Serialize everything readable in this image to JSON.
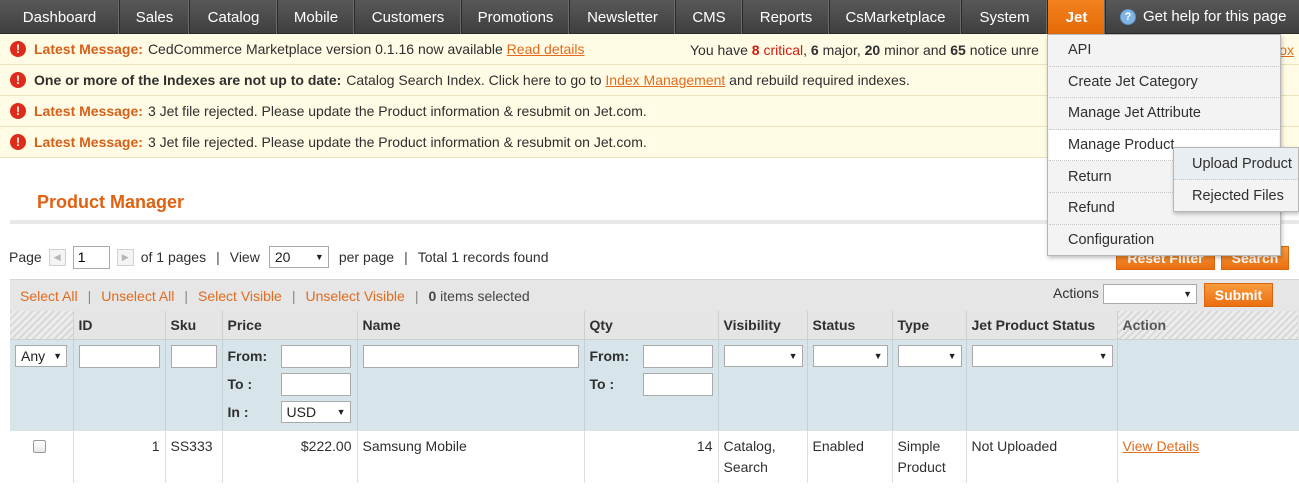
{
  "nav": {
    "items": [
      {
        "label": "Dashboard"
      },
      {
        "label": "Sales"
      },
      {
        "label": "Catalog"
      },
      {
        "label": "Mobile"
      },
      {
        "label": "Customers"
      },
      {
        "label": "Promotions"
      },
      {
        "label": "Newsletter"
      },
      {
        "label": "CMS"
      },
      {
        "label": "Reports"
      },
      {
        "label": "CsMarketplace"
      },
      {
        "label": "System"
      },
      {
        "label": "Jet"
      }
    ],
    "help_label": "Get help for this page",
    "help_icon": "question-circle-icon"
  },
  "messages": {
    "m1": {
      "title": "Latest Message:",
      "text": "CedCommerce Marketplace version 0.1.16 now available",
      "link": "Read details"
    },
    "notice": {
      "prefix": "You have",
      "critical_count": "8",
      "critical_label": "critical",
      "major_count": "6",
      "major_label": "major,",
      "minor_count": "20",
      "minor_label": "minor and",
      "notice_count": "65",
      "notice_label": "notice unre",
      "right_fragment": "ox"
    },
    "m2": {
      "title": "One or more of the Indexes are not up to date:",
      "text_before": "Catalog Search Index. Click here to go to",
      "link": "Index Management",
      "text_after": "and rebuild required indexes."
    },
    "m3": {
      "title": "Latest Message:",
      "text": "3 Jet file rejected. Please update the Product information & resubmit on Jet.com."
    },
    "m4": {
      "title": "Latest Message:",
      "text": "3 Jet file rejected. Please update the Product information & resubmit on Jet.com."
    }
  },
  "page": {
    "title": "Product Manager"
  },
  "pager": {
    "page_label": "Page",
    "page_value": "1",
    "of_pages": "of 1 pages",
    "view_label": "View",
    "per_page_value": "20",
    "per_page_label": "per page",
    "total": "Total 1 records found"
  },
  "buttons": {
    "reset_filter": "Reset Filter",
    "search": "Search",
    "submit": "Submit"
  },
  "massaction": {
    "select_all": "Select All",
    "unselect_all": "Unselect All",
    "select_visible": "Select Visible",
    "unselect_visible": "Unselect Visible",
    "items_count": "0",
    "items_label": "items selected",
    "actions_label": "Actions",
    "actions_value": ""
  },
  "grid": {
    "columns": [
      "",
      "ID",
      "Sku",
      "Price",
      "Name",
      "Qty",
      "Visibility",
      "Status",
      "Type",
      "Jet Product Status",
      "Action"
    ],
    "filter": {
      "any": "Any",
      "from": "From:",
      "to": "To :",
      "in": "In :",
      "currency": "USD"
    },
    "rows": [
      {
        "id": "1",
        "sku": "SS333",
        "price": "$222.00",
        "name": "Samsung Mobile",
        "qty": "14",
        "visibility_line1": "Catalog,",
        "visibility_line2": "Search",
        "status": "Enabled",
        "type_line1": "Simple",
        "type_line2": "Product",
        "jet_status": "Not Uploaded",
        "action": "View Details"
      }
    ]
  },
  "jet_menu": {
    "items": [
      {
        "label": "API"
      },
      {
        "label": "Create Jet Category"
      },
      {
        "label": "Manage Jet Attribute"
      },
      {
        "label": "Manage Product"
      },
      {
        "label": "Return"
      },
      {
        "label": "Refund"
      },
      {
        "label": "Configuration"
      }
    ],
    "submenu": [
      {
        "label": "Upload Product"
      },
      {
        "label": "Rejected Files"
      }
    ]
  },
  "colors": {
    "accent": "#e0610f",
    "nav_active": "#ea6f10",
    "message_bg": "#fffbe4",
    "filter_bg": "#d7e5ea"
  }
}
